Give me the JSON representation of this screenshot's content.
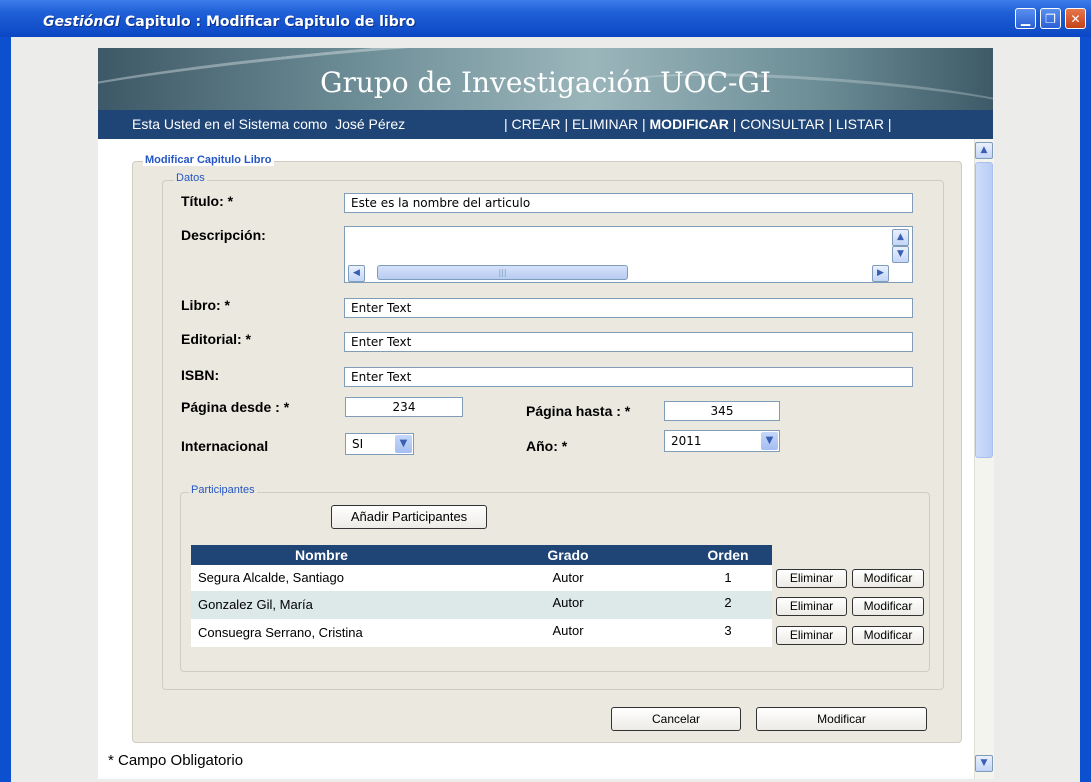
{
  "window": {
    "app_name": "GestiónGI",
    "title": "Capitulo : Modificar Capitulo de libro",
    "minimize": "▁",
    "restore": "❐",
    "close": "✕"
  },
  "header": {
    "banner_title": "Grupo de Investigación UOC-GI",
    "user_prefix": "Esta Usted en el Sistema como",
    "user_name": "José Pérez",
    "nav": {
      "sep": "|",
      "crear": "CREAR",
      "eliminar": "ELIMINAR",
      "modificar": "MODIFICAR",
      "consultar": "CONSULTAR",
      "listar": "LISTAR"
    }
  },
  "form": {
    "section_title": "Modificar Capitulo Libro",
    "datos_legend": "Datos",
    "titulo_label": "Título: *",
    "titulo_value": "Este es la nombre del articulo",
    "descripcion_label": "Descripción:",
    "descripcion_value": "",
    "libro_label": "Libro: *",
    "libro_value": "Enter Text",
    "editorial_label": "Editorial: *",
    "editorial_value": "Enter Text",
    "isbn_label": "ISBN:",
    "isbn_value": "Enter Text",
    "pagina_desde_label": "Página desde : *",
    "pagina_desde_value": "234",
    "pagina_hasta_label": "Página hasta : *",
    "pagina_hasta_value": "345",
    "internacional_label": "Internacional",
    "internacional_value": "SI",
    "anio_label": "Año: *",
    "anio_value": "2011"
  },
  "participantes": {
    "legend": "Participantes",
    "add_button": "Añadir Participantes",
    "columns": {
      "nombre": "Nombre",
      "grado": "Grado",
      "orden": "Orden"
    },
    "rows": [
      {
        "nombre": "Segura Alcalde, Santiago",
        "grado": "Autor",
        "orden": "1"
      },
      {
        "nombre": "Gonzalez Gil, María",
        "grado": "Autor",
        "orden": "2"
      },
      {
        "nombre": "Consuegra Serrano, Cristina",
        "grado": "Autor",
        "orden": "3"
      }
    ],
    "eliminar_label": "Eliminar",
    "modificar_label": "Modificar"
  },
  "actions": {
    "cancelar": "Cancelar",
    "modificar": "Modificar"
  },
  "footnote": "* Campo Obligatorio",
  "icons": {
    "scroll_up": "▲",
    "scroll_down": "▼",
    "scroll_left": "◀",
    "scroll_right": "▶",
    "dropdown": "▼",
    "grip": "|||"
  },
  "colors": {
    "titlebar": "#0b47c4",
    "navbar": "#1f4577",
    "legend_text": "#2456c4",
    "panel_bg": "#ebe8e0"
  }
}
